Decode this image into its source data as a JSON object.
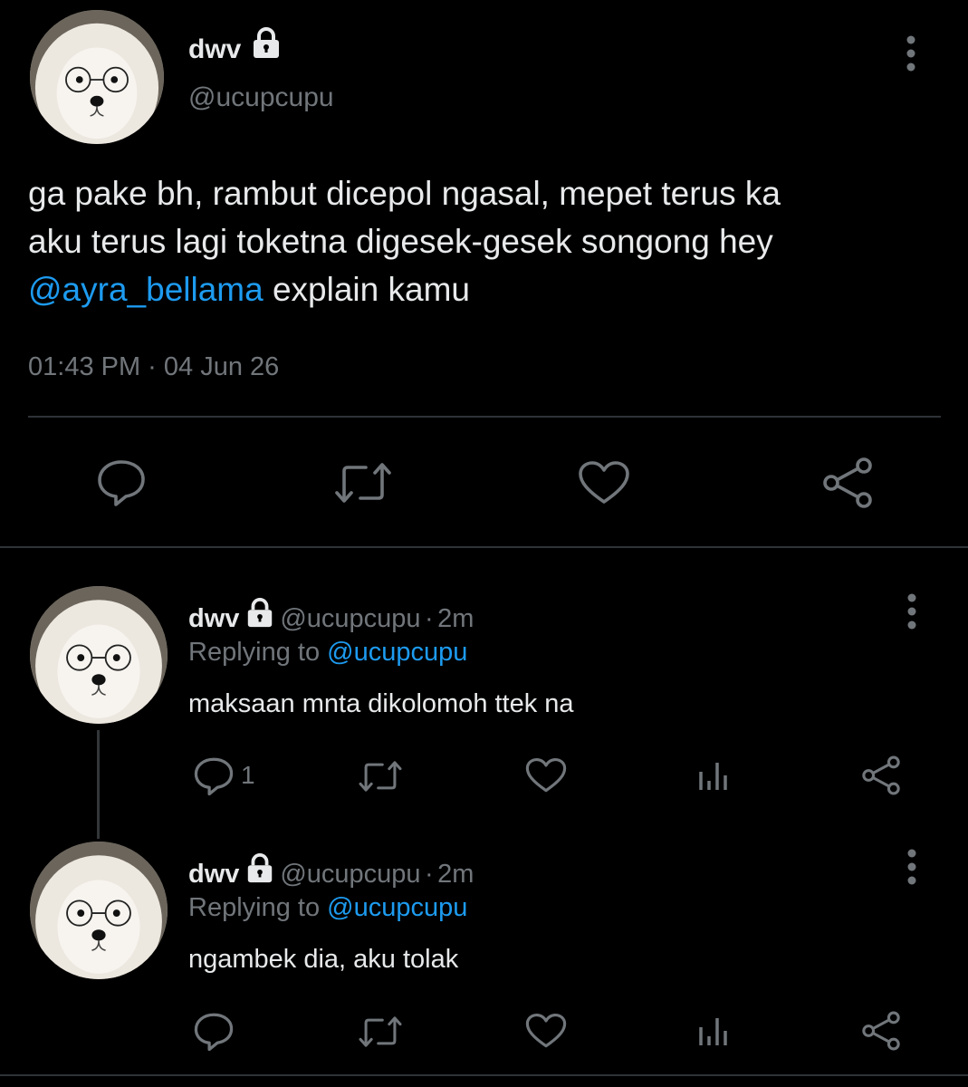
{
  "main_tweet": {
    "author_name": "dwv",
    "author_handle": "@ucupcupu",
    "text_line1": "ga pake bh, rambut dicepol ngasal, mepet terus ka",
    "text_line2": "aku terus lagi toketna digesek-gesek songong hey",
    "mention": "@ayra_bellama",
    "text_line3_rest": " explain kamu",
    "timestamp": "01:43 PM · 04 Jun 26",
    "icons": [
      "comment-icon",
      "retweet-icon",
      "like-icon",
      "share-icon"
    ]
  },
  "replies": [
    {
      "author_name": "dwv",
      "author_handle": "@ucupcupu",
      "time": "2m",
      "replying_prefix": "Replying to ",
      "replying_to": "@ucupcupu",
      "text": "maksaan mnta dikolomoh ttek na",
      "reply_count": "1"
    },
    {
      "author_name": "dwv",
      "author_handle": "@ucupcupu",
      "time": "2m",
      "replying_prefix": "Replying to ",
      "replying_to": "@ucupcupu",
      "text": "ngambek dia, aku tolak",
      "reply_count": ""
    }
  ],
  "colors": {
    "background": "#000000",
    "text": "#e7e9ea",
    "muted": "#71767b",
    "accent": "#1d9bf0",
    "divider": "#2f3336"
  }
}
